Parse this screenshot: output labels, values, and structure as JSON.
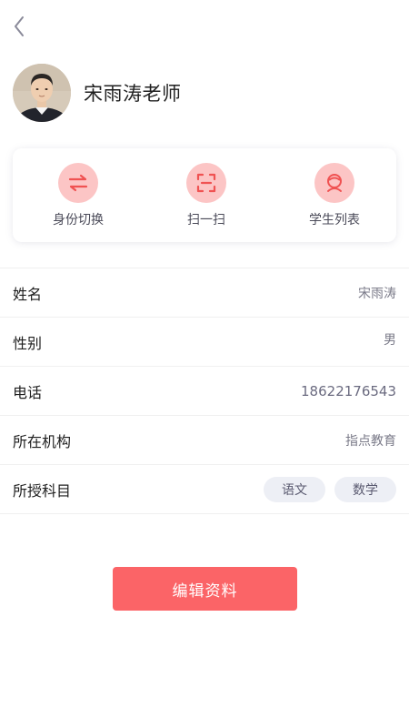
{
  "header": {
    "back_icon": "chevron-left-icon"
  },
  "profile": {
    "name": "宋雨涛老师",
    "avatar_icon": "teacher-portrait-photo"
  },
  "actions": [
    {
      "label": "身份切换",
      "icon": "swap-arrows-icon"
    },
    {
      "label": "扫一扫",
      "icon": "scan-frame-icon"
    },
    {
      "label": "学生列表",
      "icon": "student-avatar-icon"
    }
  ],
  "info": {
    "name": {
      "label": "姓名",
      "value": "宋雨涛"
    },
    "gender": {
      "label": "性别",
      "value": "男"
    },
    "phone": {
      "label": "电话",
      "value": "18622176543"
    },
    "org": {
      "label": "所在机构",
      "value": "指点教育"
    },
    "subjects": {
      "label": "所授科目",
      "tags": [
        "语文",
        "数学"
      ]
    }
  },
  "edit_button": {
    "label": "编辑资料"
  },
  "colors": {
    "accent": "#fb6467",
    "icon_bg": "#fcc5c5",
    "icon_fg": "#f05252",
    "tag_bg": "#edeff5"
  }
}
